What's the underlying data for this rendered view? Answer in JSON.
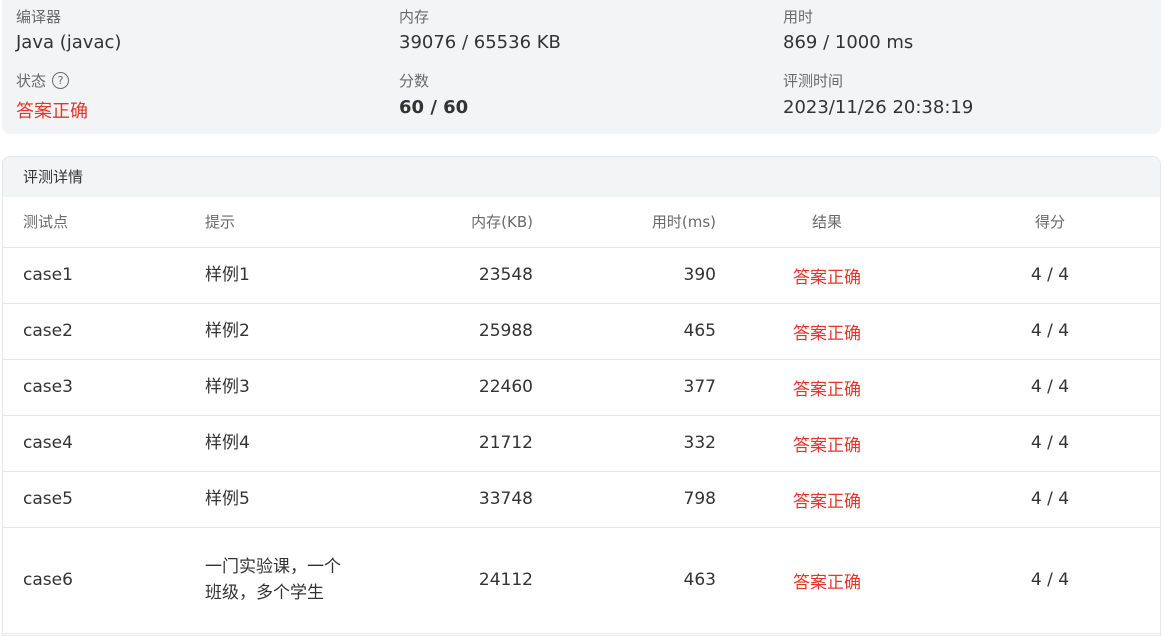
{
  "summary": {
    "compiler_label": "编译器",
    "compiler_value": "Java (javac)",
    "memory_label": "内存",
    "memory_value": "39076 / 65536 KB",
    "time_label": "用时",
    "time_value": "869 / 1000 ms",
    "status_label": "状态",
    "status_help_icon": "question-circle-icon",
    "status_value": "答案正确",
    "score_label": "分数",
    "score_value": "60 / 60",
    "judge_time_label": "评测时间",
    "judge_time_value": "2023/11/26 20:38:19"
  },
  "details": {
    "title": "评测详情",
    "columns": [
      "测试点",
      "提示",
      "内存(KB)",
      "用时(ms)",
      "结果",
      "得分"
    ],
    "rows": [
      {
        "case": "case1",
        "hint": "样例1",
        "memory": "23548",
        "time": "390",
        "result": "答案正确",
        "score": "4 / 4"
      },
      {
        "case": "case2",
        "hint": "样例2",
        "memory": "25988",
        "time": "465",
        "result": "答案正确",
        "score": "4 / 4"
      },
      {
        "case": "case3",
        "hint": "样例3",
        "memory": "22460",
        "time": "377",
        "result": "答案正确",
        "score": "4 / 4"
      },
      {
        "case": "case4",
        "hint": "样例4",
        "memory": "21712",
        "time": "332",
        "result": "答案正确",
        "score": "4 / 4"
      },
      {
        "case": "case5",
        "hint": "样例5",
        "memory": "33748",
        "time": "798",
        "result": "答案正确",
        "score": "4 / 4"
      },
      {
        "case": "case6",
        "hint": "一门实验课，一个班级，多个学生",
        "memory": "24112",
        "time": "463",
        "result": "答案正确",
        "score": "4 / 4"
      }
    ]
  },
  "colors": {
    "accepted": "#e5342a",
    "panel_background": "#f3f4f5",
    "border": "#e6e7e9"
  }
}
